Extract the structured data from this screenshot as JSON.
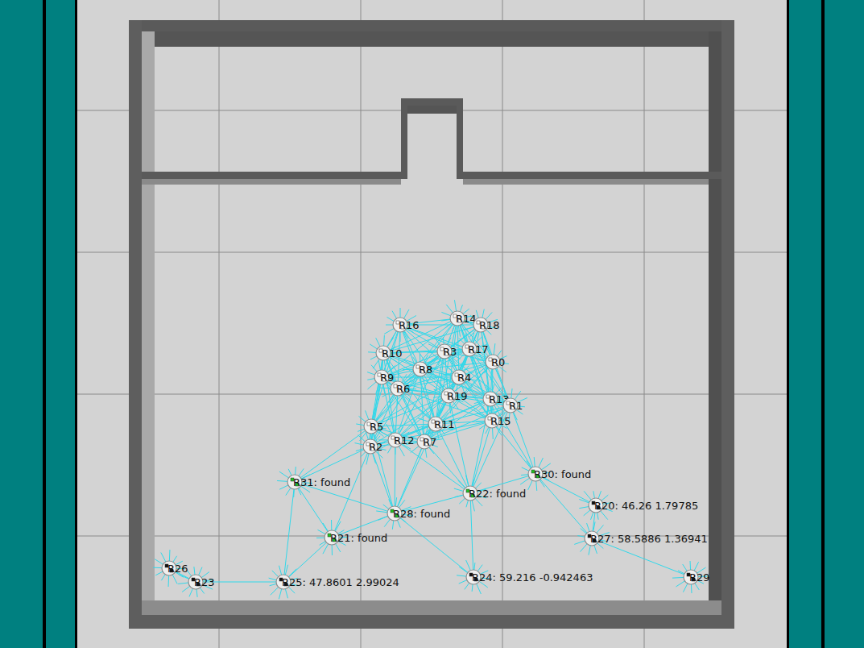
{
  "robots": [
    {
      "label": "R16",
      "kind": "idle"
    },
    {
      "label": "R14",
      "kind": "idle"
    },
    {
      "label": "R18",
      "kind": "idle"
    },
    {
      "label": "R10",
      "kind": "idle"
    },
    {
      "label": "R3",
      "kind": "idle"
    },
    {
      "label": "R17",
      "kind": "idle"
    },
    {
      "label": "R0",
      "kind": "idle"
    },
    {
      "label": "R8",
      "kind": "idle"
    },
    {
      "label": "R9",
      "kind": "idle"
    },
    {
      "label": "R4",
      "kind": "idle"
    },
    {
      "label": "R6",
      "kind": "idle"
    },
    {
      "label": "R19",
      "kind": "idle"
    },
    {
      "label": "R13",
      "kind": "idle"
    },
    {
      "label": "R1",
      "kind": "idle"
    },
    {
      "label": "R15",
      "kind": "idle"
    },
    {
      "label": "R11",
      "kind": "idle"
    },
    {
      "label": "R5",
      "kind": "idle"
    },
    {
      "label": "R12",
      "kind": "idle"
    },
    {
      "label": "R7",
      "kind": "idle"
    },
    {
      "label": "R2",
      "kind": "idle"
    },
    {
      "label": "R31: found",
      "kind": "found"
    },
    {
      "label": "R30: found",
      "kind": "found"
    },
    {
      "label": "R22: found",
      "kind": "found"
    },
    {
      "label": "R28: found",
      "kind": "found"
    },
    {
      "label": "R21: found",
      "kind": "found"
    },
    {
      "label": "R20: 46.26 1.79785",
      "kind": "searching"
    },
    {
      "label": "R27: 58.5886 1.36941",
      "kind": "searching"
    },
    {
      "label": "R26",
      "kind": "searching"
    },
    {
      "label": "R23",
      "kind": "searching"
    },
    {
      "label": "R25: 47.8601 2.99024",
      "kind": "searching"
    },
    {
      "label": "R24: 59.216 -0.942463",
      "kind": "searching"
    },
    {
      "label": "R29",
      "kind": "searching"
    }
  ]
}
